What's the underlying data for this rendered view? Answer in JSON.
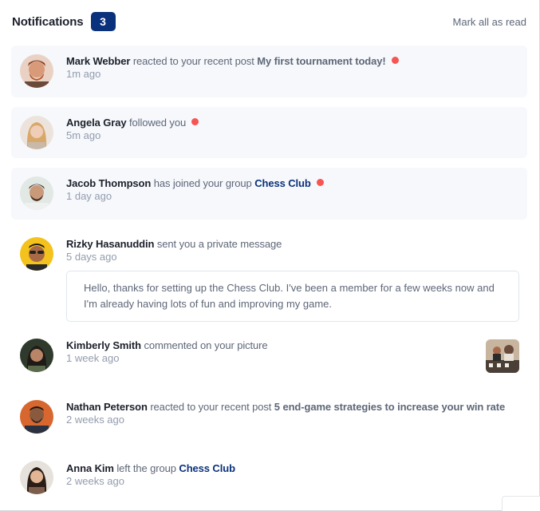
{
  "header": {
    "title": "Notifications",
    "unread_count": "3",
    "mark_all_label": "Mark all as read"
  },
  "notifications": [
    {
      "name": "Mark Webber",
      "action": "reacted to your recent post",
      "object": "My first tournament today!",
      "time": "1m ago",
      "unread": true
    },
    {
      "name": "Angela Gray",
      "action": "followed you",
      "time": "5m ago",
      "unread": true
    },
    {
      "name": "Jacob Thompson",
      "action": "has joined your group",
      "object": "Chess Club",
      "time": "1 day ago",
      "unread": true
    },
    {
      "name": "Rizky Hasanuddin",
      "action": "sent you a private message",
      "time": "5 days ago",
      "unread": false,
      "message": "Hello, thanks for setting up the Chess Club. I've been a member for a few weeks now and I'm already having lots of fun and improving my game."
    },
    {
      "name": "Kimberly Smith",
      "action": "commented on your picture",
      "time": "1 week ago",
      "unread": false
    },
    {
      "name": "Nathan Peterson",
      "action": "reacted to your recent post",
      "object": "5 end-game strategies to increase your win rate",
      "time": "2 weeks ago",
      "unread": false
    },
    {
      "name": "Anna Kim",
      "action": "left the group",
      "object": "Chess Club",
      "time": "2 weeks ago",
      "unread": false
    }
  ],
  "colors": {
    "accent": "#0a317b",
    "unread_dot": "#f65552",
    "unread_bg": "#f6f8fc",
    "muted_text": "#5e6778",
    "time_text": "#939cad"
  }
}
